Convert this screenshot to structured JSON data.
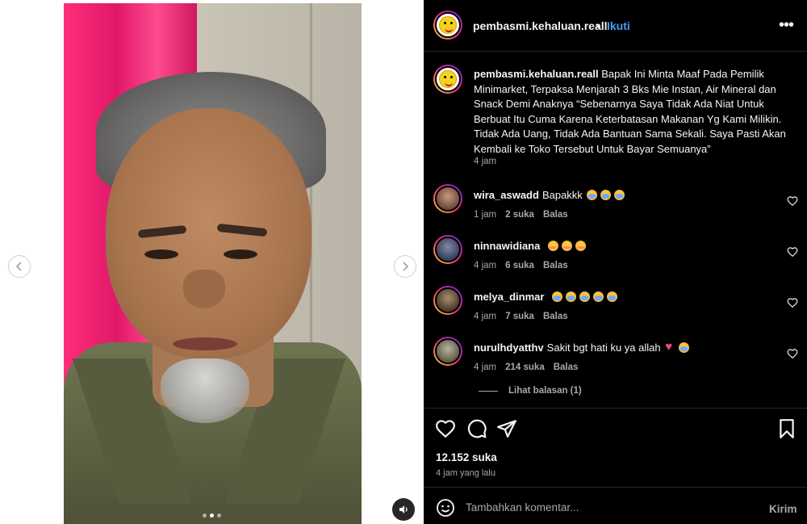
{
  "post": {
    "username": "pembasmi.kehaluan.reall",
    "bullet": "•",
    "follow_label": "Ikuti",
    "more_label": "•••",
    "caption_text": "Bapak Ini Minta Maaf Pada Pemilik Minimarket, Terpaksa Menjarah 3 Bks Mie Instan, Air Mineral dan Snack Demi Anaknya “Sebenarnya Saya Tidak Ada Niat Untuk Berbuat Itu Cuma Karena Keterbatasan Makanan Yg Kami Milikin. Tidak Ada Uang, Tidak Ada Bantuan Sama Sekali. Saya Pasti Akan Kembali ke Toko Tersebut Untuk Bayar Semuanya”",
    "caption_time": "4 jam",
    "likes": "12.152 suka",
    "posted_ago": "4 jam yang lalu"
  },
  "comments": [
    {
      "username": "wira_aswadd",
      "text": "Bapakkk",
      "emojis": [
        "cry",
        "cry",
        "cry"
      ],
      "time": "1 jam",
      "likes": "2 suka",
      "reply": "Balas",
      "avatar_color": "#6b4a3a"
    },
    {
      "username": "ninnawidiana",
      "text": "",
      "emojis": [
        "flush",
        "flush",
        "flush"
      ],
      "time": "4 jam",
      "likes": "6 suka",
      "reply": "Balas",
      "avatar_color": "#3a3f5a"
    },
    {
      "username": "melya_dinmar",
      "text": "",
      "emojis": [
        "cry",
        "cry",
        "cry",
        "cry",
        "cry"
      ],
      "time": "4 jam",
      "likes": "7 suka",
      "reply": "Balas",
      "avatar_color": "#4a3b2e"
    },
    {
      "username": "nurulhdyatthv",
      "text": "Sakit bgt hati ku ya allah",
      "emojis": [
        "heart",
        "cry"
      ],
      "time": "4 jam",
      "likes": "214 suka",
      "reply": "Balas",
      "avatar_color": "#5d5f4a"
    }
  ],
  "view_replies": "Lihat balasan (1)",
  "comment_box": {
    "placeholder": "Tambahkan komentar...",
    "send_label": "Kirim"
  },
  "icons": {
    "like": "heart-icon",
    "comment": "comment-icon",
    "share": "send-icon",
    "save": "bookmark-icon",
    "emoji": "emoji-icon",
    "mute": "speaker-icon",
    "prev": "chevron-left-icon",
    "next": "chevron-right-icon"
  },
  "colors": {
    "accent": "#4a9ff5",
    "background": "#000000",
    "muted_text": "#a8a8a8"
  },
  "carousel": {
    "total": 3,
    "active": 2
  }
}
